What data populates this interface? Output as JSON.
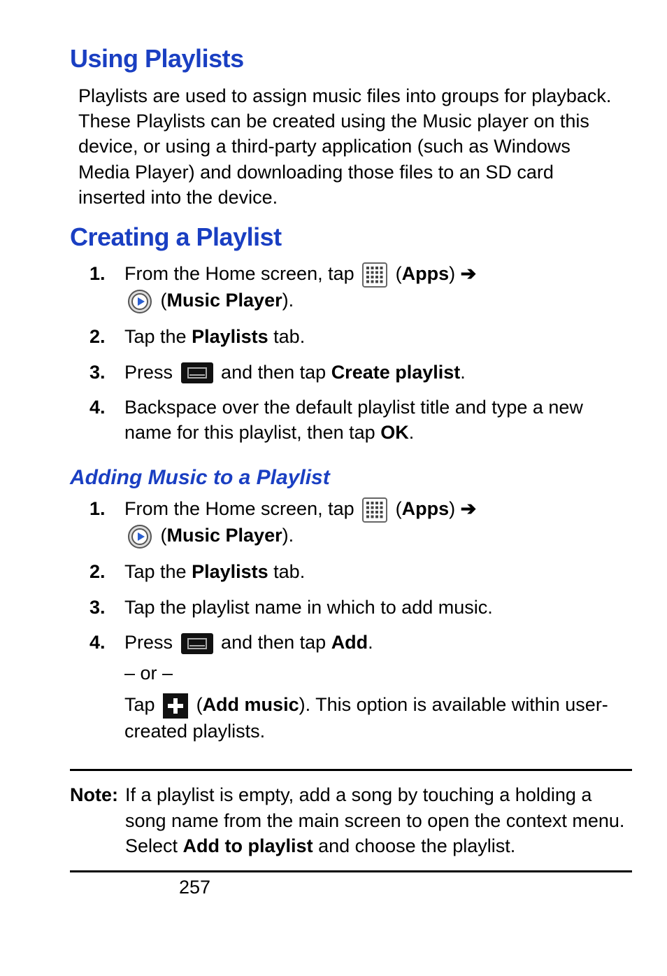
{
  "headings": {
    "using_playlists": "Using Playlists",
    "creating_playlist": "Creating a Playlist",
    "adding_music": "Adding Music to a Playlist"
  },
  "intro": "Playlists are used to assign music files into groups for playback. These Playlists can be created using the Music player on this device, or using a third-party application (such as Windows Media Player) and downloading those files to an SD card inserted into the device.",
  "labels": {
    "apps": "Apps",
    "music_player": "Music Player",
    "playlists": "Playlists",
    "create_playlist": "Create playlist",
    "ok": "OK",
    "add": "Add",
    "add_music": "Add music",
    "add_to_playlist": "Add to playlist"
  },
  "create_steps": {
    "s1a": "From the Home screen, tap ",
    "s1b_open": " (",
    "s1b_close": ") ",
    "s1c_open": " (",
    "s1c_close": ").",
    "s2a": "Tap the ",
    "s2b": " tab.",
    "s3a": "Press ",
    "s3b": " and then tap ",
    "s3c": ".",
    "s4a": "Backspace over the default playlist title and type a new name for this playlist, then tap ",
    "s4b": "."
  },
  "add_steps": {
    "s1a": "From the Home screen, tap ",
    "s1b_open": " (",
    "s1b_close": ") ",
    "s1c_open": " (",
    "s1c_close": ").",
    "s2a": "Tap the ",
    "s2b": " tab.",
    "s3": "Tap the playlist name in which to add music.",
    "s4a": "Press ",
    "s4b": " and then tap ",
    "s4c": ".",
    "or": "– or –",
    "s4d": "Tap ",
    "s4e_open": " (",
    "s4e_close": "). This option is available within user-created playlists."
  },
  "note": {
    "label": "Note:",
    "text_a": " If a playlist is empty, add a song by touching a holding a song name from the main screen to open the context menu. Select ",
    "text_b": " and choose the playlist."
  },
  "nums": {
    "n1": "1.",
    "n2": "2.",
    "n3": "3.",
    "n4": "4."
  },
  "arrow": "➔",
  "page_number": "257"
}
